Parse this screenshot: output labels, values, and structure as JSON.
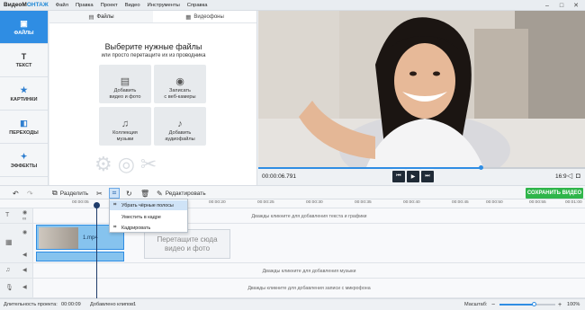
{
  "app": {
    "logo_prefix": "ВидеоМ",
    "logo_suffix": "ОНТАЖ"
  },
  "menu": [
    "Файл",
    "Правка",
    "Проект",
    "Видео",
    "Инструменты",
    "Справка"
  ],
  "nav": [
    {
      "label": "ФАЙЛЫ",
      "icon": "folder-icon",
      "active": true
    },
    {
      "label": "ТЕКСТ",
      "icon": "text-icon",
      "active": false
    },
    {
      "label": "КАРТИНКИ",
      "icon": "star-icon",
      "active": false
    },
    {
      "label": "ПЕРЕХОДЫ",
      "icon": "transitions-icon",
      "active": false
    },
    {
      "label": "ЭФФЕКТЫ",
      "icon": "effects-icon",
      "active": false
    }
  ],
  "files_panel": {
    "tabs": [
      {
        "label": "Файлы",
        "active": true
      },
      {
        "label": "Видеофоны",
        "active": false
      }
    ],
    "title": "Выберите нужные файлы",
    "subtitle": "или просто перетащите их из проводника",
    "tiles": [
      {
        "line1": "Добавить",
        "line2": "видео и фото",
        "icon": "add-video-icon"
      },
      {
        "line1": "Записать",
        "line2": "с веб-камеры",
        "icon": "webcam-icon"
      },
      {
        "line1": "Коллекция",
        "line2": "музыки",
        "icon": "music-collection-icon"
      },
      {
        "line1": "Добавить",
        "line2": "аудиофайлы",
        "icon": "add-audio-icon"
      }
    ]
  },
  "player": {
    "timecode": "00:00:06.791",
    "progress": 0.68,
    "aspect_ratio": "16:9"
  },
  "toolbar": {
    "split_label": "Разделить",
    "edit_label": "Редактировать",
    "save_label": "СОХРАНИТЬ ВИДЕО"
  },
  "crop_menu": [
    {
      "label": "Убрать чёрные полосы",
      "highlighted": true
    },
    {
      "label": "Уместить в кадре",
      "highlighted": false
    },
    {
      "label": "Кадрировать",
      "highlighted": false
    }
  ],
  "ruler": [
    "00:00:05",
    "00:00:20",
    "00:00:25",
    "00:00:30",
    "00:00:35",
    "00:00:40",
    "00:00:45",
    "00:00:50",
    "00:00:55",
    "00:01:00"
  ],
  "timeline": {
    "text_hint": "Дважды кликните для добавления текста и графики",
    "clip_name": "1.mp4",
    "dropzone_line1": "Перетащите сюда",
    "dropzone_line2": "видео и фото",
    "music_hint": "Дважды кликните для добавления музыки",
    "mic_hint": "Дважды кликните для добавления записи с микрофона"
  },
  "status": {
    "duration_label": "Длительность проекта:",
    "duration_value": "00:00:09",
    "clips_label": "Добавлено клипов:",
    "clips_value": "1",
    "zoom_label": "Масштаб:",
    "zoom_value": "100%"
  },
  "colors": {
    "accent": "#2f8de3",
    "save": "#2fb54a",
    "clip": "#86c3ee"
  }
}
